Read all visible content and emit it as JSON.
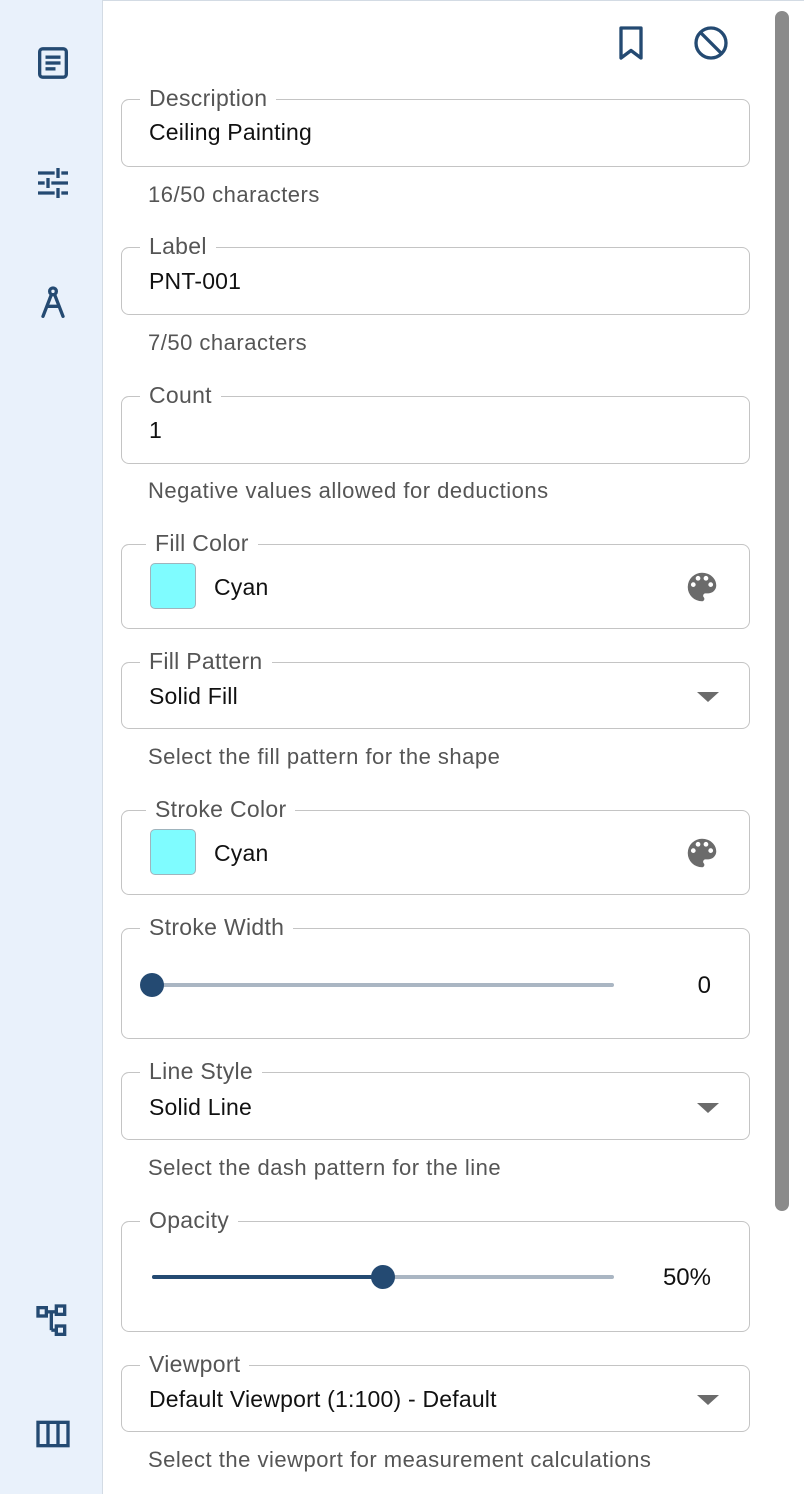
{
  "sidebar": {
    "items": [
      {
        "name": "details",
        "icon": "article-icon"
      },
      {
        "name": "settings",
        "icon": "tune-icon"
      },
      {
        "name": "measure",
        "icon": "compass-icon"
      },
      {
        "name": "hierarchy",
        "icon": "tree-icon"
      },
      {
        "name": "columns",
        "icon": "columns-icon"
      }
    ]
  },
  "toolbar": {
    "bookmark_icon": "bookmark-icon",
    "block_icon": "block-icon"
  },
  "colors": {
    "accent": "#244a72",
    "swatch_cyan": "#7ffcff",
    "sidebar_bg": "#e9f1fb"
  },
  "form": {
    "description": {
      "label": "Description",
      "value": "Ceiling Painting",
      "helper": "16/50 characters"
    },
    "label": {
      "label": "Label",
      "value": "PNT-001",
      "helper": "7/50 characters"
    },
    "count": {
      "label": "Count",
      "value": "1",
      "helper": "Negative values allowed for deductions"
    },
    "fill_color": {
      "label": "Fill Color",
      "value": "Cyan"
    },
    "fill_pattern": {
      "label": "Fill Pattern",
      "value": "Solid Fill",
      "helper": "Select the fill pattern for the shape"
    },
    "stroke_color": {
      "label": "Stroke Color",
      "value": "Cyan"
    },
    "stroke_width": {
      "label": "Stroke Width",
      "value": "0",
      "fraction": 0.0
    },
    "line_style": {
      "label": "Line Style",
      "value": "Solid Line",
      "helper": "Select the dash pattern for the line"
    },
    "opacity": {
      "label": "Opacity",
      "value": "50%",
      "fraction": 0.5
    },
    "viewport": {
      "label": "Viewport",
      "value": "Default Viewport (1:100) - Default",
      "helper": "Select the viewport for measurement calculations"
    }
  }
}
